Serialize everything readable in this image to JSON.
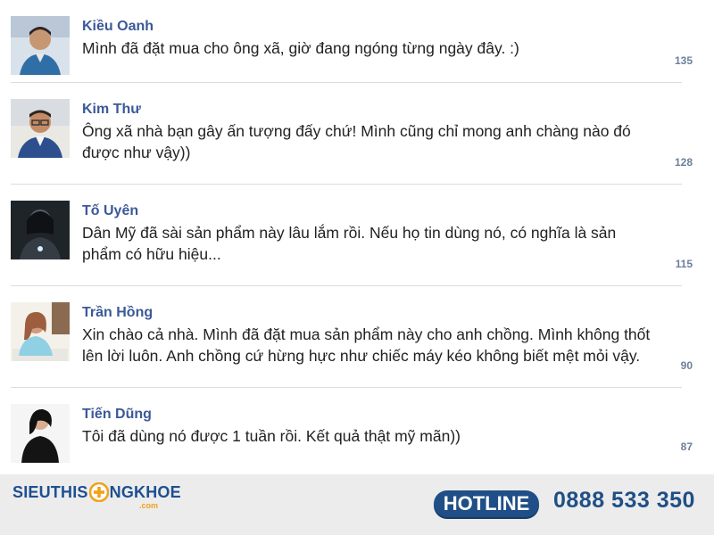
{
  "comments": [
    {
      "author": "Kiều Oanh",
      "text": "Mình đã đặt mua cho ông xã, giờ đang ngóng từng ngày đây. :)",
      "count": "135",
      "avatar": "avatar-young-man"
    },
    {
      "author": "Kim Thư",
      "text": "Ông xã nhà bạn gây ấn tượng đấy chứ! Mình cũng chỉ mong anh chàng nào đó\nđược như vậy))",
      "count": "128",
      "avatar": "avatar-man-glasses"
    },
    {
      "author": "Tố Uyên",
      "text": "Dân Mỹ đã sài sản phẩm này lâu lắm rồi. Nếu họ tin dùng nó, có nghĩa là sản\nphẩm có hữu hiệu...",
      "count": "115",
      "avatar": "avatar-dark-figure"
    },
    {
      "author": "Trần Hồng",
      "text": "Xin chào cả nhà. Mình đã đặt mua sản phẩm này cho anh chồng. Mình không thốt\nlên lời luôn. Anh chồng cứ hừng hực như chiếc máy kéo không biết mệt mỏi vậy.",
      "count": "90",
      "avatar": "avatar-woman-desk"
    },
    {
      "author": "Tiến Dũng",
      "text": "Tôi đã dùng nó được 1 tuần rồi. Kết quả thật mỹ mãn))",
      "count": "87",
      "avatar": "avatar-woman-black"
    }
  ],
  "footer": {
    "logo_left": "SIEUTHIS",
    "logo_right": "NGKHOE",
    "logo_sub": ".com",
    "hotline_label": "HOTLINE",
    "hotline_number": "0888 533 350"
  },
  "colors": {
    "name": "#3b5998",
    "text": "#222222",
    "count": "#6c7f9a",
    "brand_blue": "#1f4f86",
    "brand_orange": "#f0a21b"
  }
}
